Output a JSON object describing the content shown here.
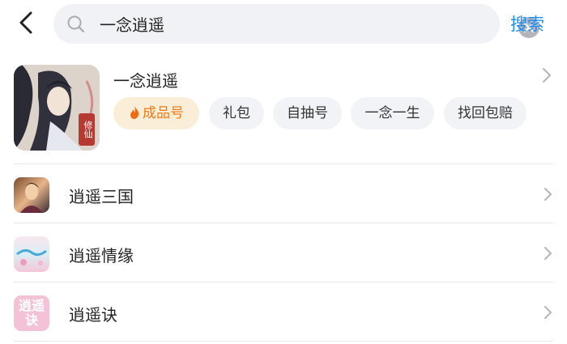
{
  "search": {
    "query": "一念逍遥",
    "submit_label": "搜索"
  },
  "featured": {
    "title": "一念逍遥",
    "seal_text": "修仙",
    "chips": [
      {
        "label": "成品号",
        "hot": true
      },
      {
        "label": "礼包",
        "hot": false
      },
      {
        "label": "自抽号",
        "hot": false
      },
      {
        "label": "一念一生",
        "hot": false
      },
      {
        "label": "找回包赔",
        "hot": false
      }
    ]
  },
  "results": [
    {
      "label": "逍遥三国",
      "icon": "game-icon-sanguo"
    },
    {
      "label": "逍遥情缘",
      "icon": "game-icon-qingyuan"
    },
    {
      "label": "逍遥诀",
      "icon": "game-icon-jue",
      "icon_text": "逍遥诀"
    }
  ],
  "colors": {
    "accent": "#1b8ef5",
    "hot_chip_bg": "#fbeed9",
    "hot_chip_text": "#f07a12"
  }
}
